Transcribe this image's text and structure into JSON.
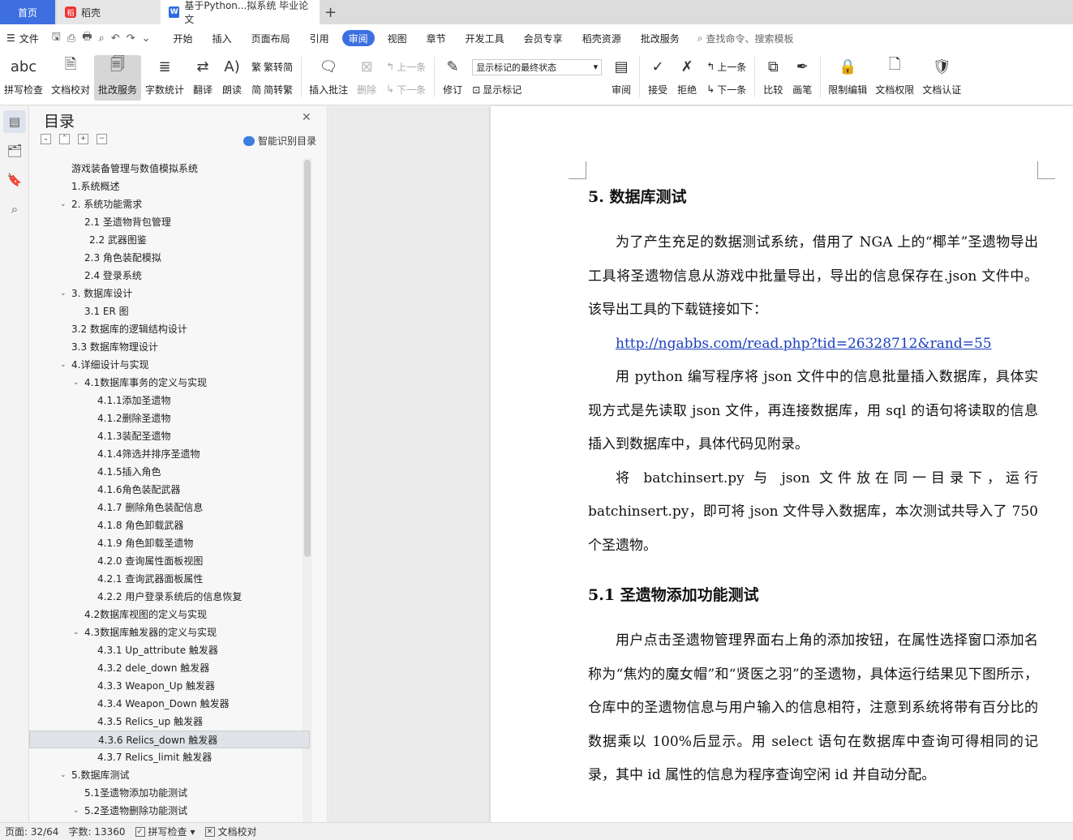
{
  "tabs": {
    "home": "首页",
    "daoke": "稻壳",
    "doc": "基于Python...拟系统 毕业论文",
    "plus": "+"
  },
  "menubar": {
    "file": "文件",
    "items": [
      "开始",
      "插入",
      "页面布局",
      "引用",
      "审阅",
      "视图",
      "章节",
      "开发工具",
      "会员专享",
      "稻壳资源",
      "批改服务"
    ],
    "active": "审阅",
    "search": "查找命令、搜索模板"
  },
  "ribbon": {
    "spell": "拼写检查",
    "doc_check": "文档校对",
    "grading": "批改服务",
    "word_count": "字数统计",
    "translate": "翻译",
    "read_aloud": "朗读",
    "trad": "繁转简",
    "simp": "简转繁",
    "insert_comment": "插入批注",
    "delete": "删除",
    "prev_comment": "上一条",
    "next_comment": "下一条",
    "revise": "修订",
    "markup_select": "显示标记的最终状态",
    "show_markup": "显示标记",
    "review": "审阅",
    "accept": "接受",
    "reject": "拒绝",
    "prev_change": "上一条",
    "next_change": "下一条",
    "compare": "比较",
    "pen": "画笔",
    "restrict": "限制编辑",
    "permission": "文档权限",
    "certify": "文档认证"
  },
  "toc": {
    "title": "目录",
    "smart": "智能识别目录",
    "items": [
      {
        "text": "游戏装备管理与数值模拟系统",
        "indent": 0
      },
      {
        "text": "1.系统概述",
        "indent": 0
      },
      {
        "text": "2. 系统功能需求",
        "indent": 0
      },
      {
        "text": "2.1 圣遗物背包管理",
        "indent": 1
      },
      {
        "text": "2.2 武器图鉴",
        "indent": 1
      },
      {
        "text": "2.3 角色装配模拟",
        "indent": 1
      },
      {
        "text": "2.4 登录系统",
        "indent": 1
      },
      {
        "text": "3. 数据库设计",
        "indent": 0
      },
      {
        "text": "3.1 ER 图",
        "indent": 1
      },
      {
        "text": "3.2 数据库的逻辑结构设计",
        "indent": 0
      },
      {
        "text": "3.3 数据库物理设计",
        "indent": 0
      },
      {
        "text": "4.详细设计与实现",
        "indent": 0
      },
      {
        "text": "4.1数据库事务的定义与实现",
        "indent": 1
      },
      {
        "text": "4.1.1添加圣遗物",
        "indent": 2
      },
      {
        "text": "4.1.2删除圣遗物",
        "indent": 2
      },
      {
        "text": "4.1.3装配圣遗物",
        "indent": 2
      },
      {
        "text": "4.1.4筛选并排序圣遗物",
        "indent": 2
      },
      {
        "text": "4.1.5插入角色",
        "indent": 2
      },
      {
        "text": "4.1.6角色装配武器",
        "indent": 2
      },
      {
        "text": "4.1.7 删除角色装配信息",
        "indent": 2
      },
      {
        "text": "4.1.8 角色卸载武器",
        "indent": 2
      },
      {
        "text": "4.1.9 角色卸载圣遗物",
        "indent": 2
      },
      {
        "text": "4.2.0 查询属性面板视图",
        "indent": 2
      },
      {
        "text": "4.2.1 查询武器面板属性",
        "indent": 2
      },
      {
        "text": "4.2.2 用户登录系统后的信息恢复",
        "indent": 2
      },
      {
        "text": "4.2数据库视图的定义与实现",
        "indent": 1
      },
      {
        "text": "4.3数据库触发器的定义与实现",
        "indent": 1
      },
      {
        "text": "4.3.1 Up_attribute 触发器",
        "indent": 2
      },
      {
        "text": "4.3.2 dele_down 触发器",
        "indent": 2
      },
      {
        "text": "4.3.3 Weapon_Up 触发器",
        "indent": 2
      },
      {
        "text": "4.3.4 Weapon_Down 触发器",
        "indent": 2
      },
      {
        "text": "4.3.5 Relics_up 触发器",
        "indent": 2
      },
      {
        "text": "4.3.6 Relics_down 触发器",
        "indent": 2
      },
      {
        "text": "4.3.7 Relics_limit 触发器",
        "indent": 2
      },
      {
        "text": "5.数据库测试",
        "indent": 0
      },
      {
        "text": "5.1圣遗物添加功能测试",
        "indent": 1
      },
      {
        "text": "5.2圣遗物删除功能测试",
        "indent": 1
      }
    ]
  },
  "document": {
    "heading1": "5.  数据库测试",
    "para1": "为了产生充足的数据测试系统，借用了 NGA 上的“椰羊”圣遗物导出工具将圣遗物信息从游戏中批量导出，导出的信息保存在.json 文件中。该导出工具的下载链接如下：",
    "link": "http://ngabbs.com/read.php?tid=26328712&rand=55",
    "para2": "用 python 编写程序将 json 文件中的信息批量插入数据库，具体实现方式是先读取 json 文件，再连接数据库，用 sql 的语句将读取的信息插入到数据库中，具体代码见附录。",
    "para3": "将 batchinsert.py  与 json 文件放在同一目录下，运行 batchinsert.py，即可将 json 文件导入数据库，本次测试共导入了 750 个圣遗物。",
    "heading2": "5.1  圣遗物添加功能测试",
    "para4": "用户点击圣遗物管理界面右上角的添加按钮，在属性选择窗口添加名称为“焦灼的魔女帽”和“贤医之羽”的圣遗物，具体运行结果见下图所示，仓库中的圣遗物信息与用户输入的信息相符，注意到系统将带有百分比的数据乘以 100%后显示。用 select 语句在数据库中查询可得相同的记录，其中 id 属性的信息为程序查询空闲 id 并自动分配。"
  },
  "status": {
    "page": "页面: 32/64",
    "words": "字数: 13360",
    "spell": "拼写检查",
    "doccheck": "文档校对"
  }
}
